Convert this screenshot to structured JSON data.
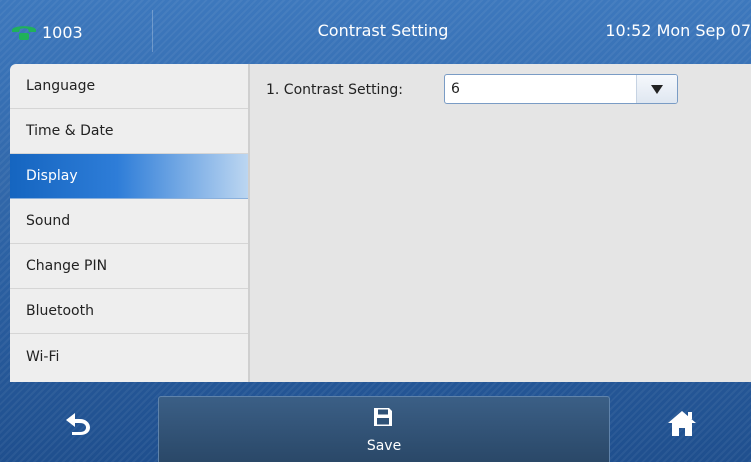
{
  "header": {
    "account": "1003",
    "title": "Contrast Setting",
    "datetime": "10:52 Mon Sep 07"
  },
  "sidebar": {
    "items": [
      {
        "label": "Language"
      },
      {
        "label": "Time & Date"
      },
      {
        "label": "Display",
        "active": true
      },
      {
        "label": "Sound"
      },
      {
        "label": "Change PIN"
      },
      {
        "label": "Bluetooth"
      },
      {
        "label": "Wi-Fi"
      }
    ]
  },
  "main": {
    "contrast_label": "1. Contrast Setting:",
    "contrast_value": "6"
  },
  "softkeys": {
    "back_icon": "back-arrow-icon",
    "save_icon": "floppy-disk-icon",
    "save_label": "Save",
    "home_icon": "home-icon"
  },
  "colors": {
    "accent": "#1565c0",
    "phone_icon": "#20b15a",
    "background": "#2a5d9a"
  }
}
